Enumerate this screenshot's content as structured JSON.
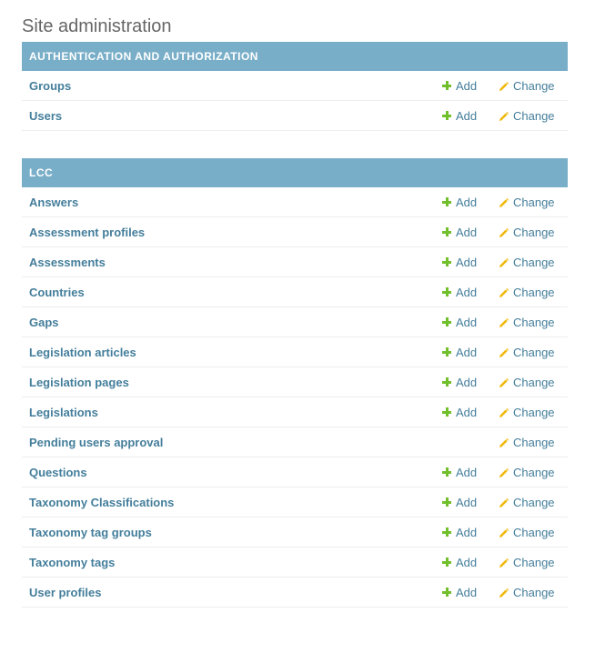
{
  "page": {
    "title": "Site administration"
  },
  "labels": {
    "add": "Add",
    "change": "Change"
  },
  "modules": [
    {
      "caption": "AUTHENTICATION AND AUTHORIZATION",
      "models": [
        {
          "name": "Groups",
          "add": true
        },
        {
          "name": "Users",
          "add": true
        }
      ]
    },
    {
      "caption": "LCC",
      "models": [
        {
          "name": "Answers",
          "add": true
        },
        {
          "name": "Assessment profiles",
          "add": true
        },
        {
          "name": "Assessments",
          "add": true
        },
        {
          "name": "Countries",
          "add": true
        },
        {
          "name": "Gaps",
          "add": true
        },
        {
          "name": "Legislation articles",
          "add": true
        },
        {
          "name": "Legislation pages",
          "add": true
        },
        {
          "name": "Legislations",
          "add": true
        },
        {
          "name": "Pending users approval",
          "add": false
        },
        {
          "name": "Questions",
          "add": true
        },
        {
          "name": "Taxonomy Classifications",
          "add": true
        },
        {
          "name": "Taxonomy tag groups",
          "add": true
        },
        {
          "name": "Taxonomy tags",
          "add": true
        },
        {
          "name": "User profiles",
          "add": true
        }
      ]
    }
  ],
  "colors": {
    "caption_bg": "#79aec8",
    "link": "#447e9b",
    "add_icon": "#70bf2b",
    "change_icon": "#efb80b"
  }
}
